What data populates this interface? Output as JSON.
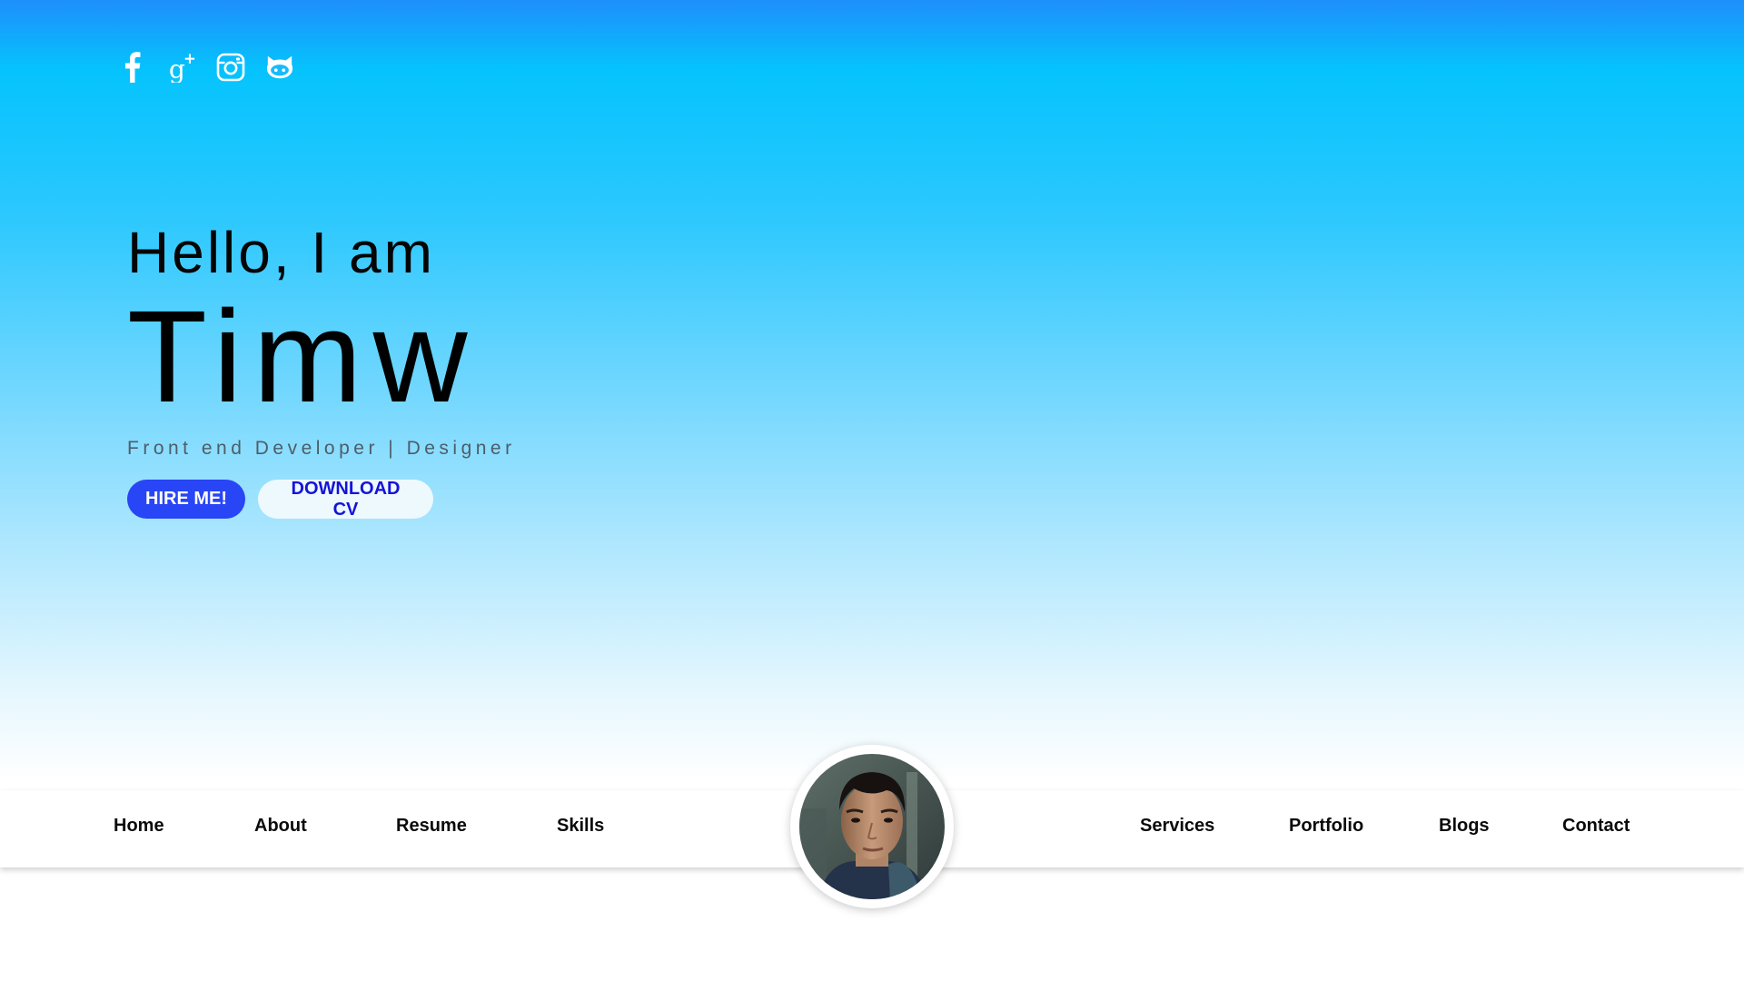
{
  "social": {
    "icons": [
      {
        "name": "facebook-icon"
      },
      {
        "name": "google-plus-icon"
      },
      {
        "name": "instagram-icon"
      },
      {
        "name": "github-icon"
      }
    ]
  },
  "hero": {
    "greeting": "Hello, I am",
    "name": "Timw",
    "subtitle": "Front end Developer | Designer",
    "hire_label": "HIRE ME!",
    "download_label": "DOWNLOAD CV"
  },
  "nav": {
    "left": [
      "Home",
      "About",
      "Resume",
      "Skills"
    ],
    "right": [
      "Services",
      "Portfolio",
      "Blogs",
      "Contact"
    ]
  },
  "colors": {
    "gradient_top": "#1e8ffb",
    "gradient_mid": "#05c3fd",
    "primary_button": "#2845f6",
    "secondary_button_text": "#1414d8"
  }
}
